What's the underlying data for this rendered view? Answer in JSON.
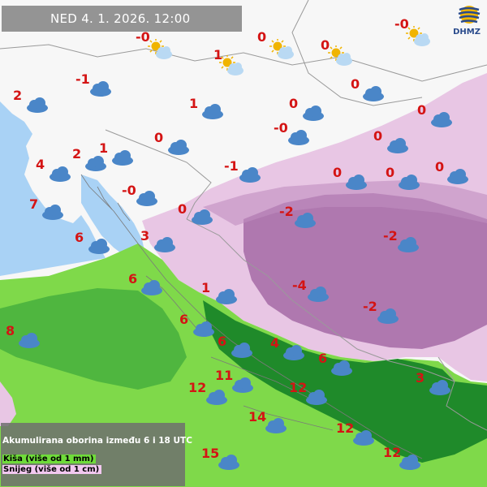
{
  "header": {
    "date_time": "NED  4. 1. 2026. 12:00"
  },
  "logo": {
    "text": "DHMZ"
  },
  "legend": {
    "title": "Akumulirana oborina između 6 i 18 UTC",
    "rain": "Kiša (više od 1 mm)",
    "snow": "Snijeg (više od 1 cm)"
  },
  "colors": {
    "temperature_text": "#d41414",
    "cloud": "#4a86c8",
    "sun": "#f0b400",
    "sea": "#a9d2f5",
    "rain_light": "#7fd94a",
    "rain_heavy": "#1f8a2a",
    "snow_light": "#e8c6e4",
    "snow_heavy": "#a46aa6"
  },
  "stations": [
    {
      "temp": "-0",
      "weather": "partly-cloudy-icon"
    },
    {
      "temp": "0",
      "weather": "partly-cloudy-icon"
    },
    {
      "temp": "0",
      "weather": "partly-cloudy-icon"
    },
    {
      "temp": "-0",
      "weather": "partly-cloudy-icon"
    },
    {
      "temp": "1",
      "weather": "partly-cloudy-icon"
    },
    {
      "temp": "-1",
      "weather": "cloud-icon"
    },
    {
      "temp": "2",
      "weather": "cloud-icon"
    },
    {
      "temp": "1",
      "weather": "cloud-icon"
    },
    {
      "temp": "0",
      "weather": "cloud-icon"
    },
    {
      "temp": "0",
      "weather": "cloud-icon"
    },
    {
      "temp": "-0",
      "weather": "cloud-icon"
    },
    {
      "temp": "0",
      "weather": "cloud-icon"
    },
    {
      "temp": "0",
      "weather": "cloud-icon"
    },
    {
      "temp": "0",
      "weather": "cloud-icon"
    },
    {
      "temp": "2",
      "weather": "cloud-icon"
    },
    {
      "temp": "1",
      "weather": "cloud-icon"
    },
    {
      "temp": "4",
      "weather": "cloud-icon"
    },
    {
      "temp": "-1",
      "weather": "cloud-icon"
    },
    {
      "temp": "0",
      "weather": "cloud-icon"
    },
    {
      "temp": "0",
      "weather": "cloud-icon"
    },
    {
      "temp": "0",
      "weather": "cloud-icon"
    },
    {
      "temp": "-0",
      "weather": "cloud-icon"
    },
    {
      "temp": "7",
      "weather": "cloud-icon"
    },
    {
      "temp": "0",
      "weather": "cloud-icon"
    },
    {
      "temp": "-2",
      "weather": "cloud-icon"
    },
    {
      "temp": "6",
      "weather": "cloud-icon"
    },
    {
      "temp": "3",
      "weather": "cloud-icon"
    },
    {
      "temp": "-2",
      "weather": "cloud-icon"
    },
    {
      "temp": "6",
      "weather": "cloud-icon"
    },
    {
      "temp": "1",
      "weather": "cloud-icon"
    },
    {
      "temp": "-4",
      "weather": "cloud-icon"
    },
    {
      "temp": "-2",
      "weather": "cloud-icon"
    },
    {
      "temp": "8",
      "weather": "cloud-icon"
    },
    {
      "temp": "6",
      "weather": "cloud-icon"
    },
    {
      "temp": "6",
      "weather": "cloud-icon"
    },
    {
      "temp": "4",
      "weather": "cloud-icon"
    },
    {
      "temp": "6",
      "weather": "cloud-icon"
    },
    {
      "temp": "11",
      "weather": "cloud-icon"
    },
    {
      "temp": "12",
      "weather": "cloud-icon"
    },
    {
      "temp": "12",
      "weather": "cloud-icon"
    },
    {
      "temp": "3",
      "weather": "cloud-icon"
    },
    {
      "temp": "14",
      "weather": "cloud-icon"
    },
    {
      "temp": "12",
      "weather": "cloud-icon"
    },
    {
      "temp": "15",
      "weather": "cloud-icon"
    },
    {
      "temp": "12",
      "weather": "cloud-icon"
    }
  ]
}
